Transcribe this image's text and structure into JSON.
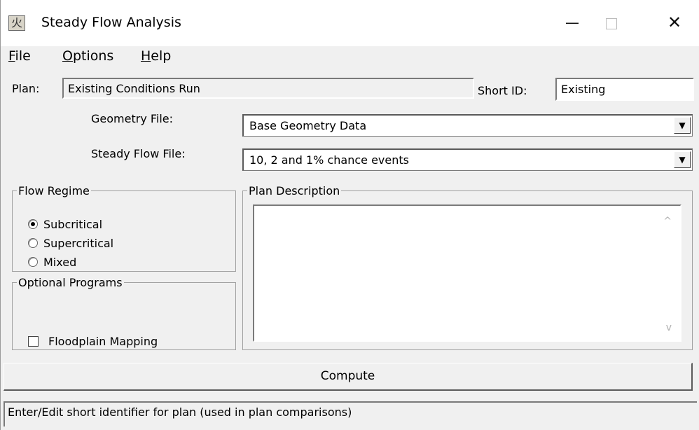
{
  "window": {
    "title": "Steady Flow Analysis",
    "icon": "hec-ras-app-icon",
    "controls": {
      "minimize": "—",
      "close": "✕"
    }
  },
  "menu": {
    "file": {
      "mnemonic": "F",
      "rest": "ile"
    },
    "options": {
      "mnemonic": "O",
      "rest": "ptions"
    },
    "help": {
      "mnemonic": "H",
      "rest": "elp"
    }
  },
  "plan": {
    "label": "Plan:",
    "value": "Existing Conditions Run",
    "short_id_label": "Short ID:",
    "short_id_value": "Existing"
  },
  "geometry": {
    "label": "Geometry File:",
    "value": "Base Geometry Data"
  },
  "steady_flow": {
    "label": "Steady Flow File:",
    "value": "10, 2 and 1% chance events"
  },
  "flow_regime": {
    "legend": "Flow Regime",
    "options": [
      "Subcritical",
      "Supercritical",
      "Mixed"
    ],
    "selected": "Subcritical"
  },
  "optional_programs": {
    "legend": "Optional Programs",
    "floodplain_label": "Floodplain Mapping",
    "floodplain_checked": false
  },
  "plan_description": {
    "legend": "Plan Description",
    "value": ""
  },
  "compute_label": "Compute",
  "status_text": "Enter/Edit short identifier for plan (used in plan comparisons)"
}
